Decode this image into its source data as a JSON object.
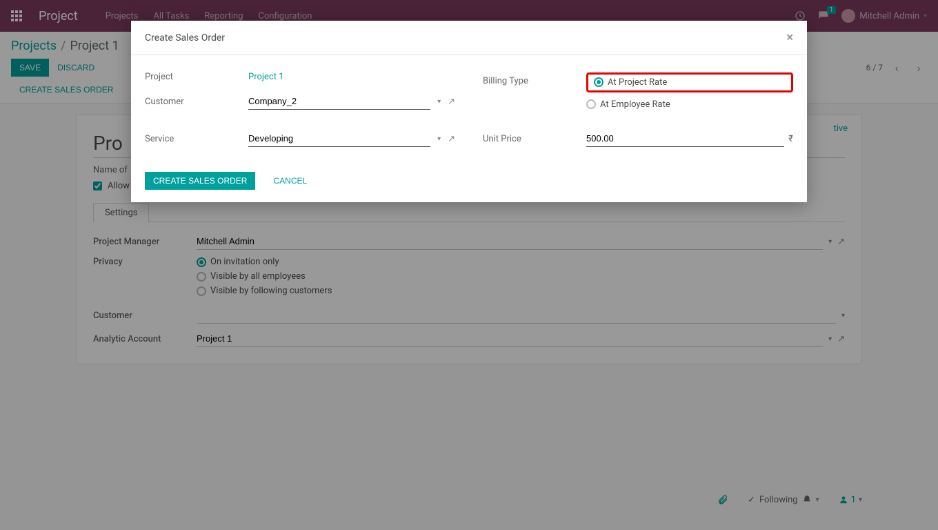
{
  "topbar": {
    "brand": "Project",
    "menu": [
      "Projects",
      "All Tasks",
      "Reporting",
      "Configuration"
    ],
    "chat_badge": "1",
    "user": "Mitchell Admin"
  },
  "breadcrumb": {
    "root": "Projects",
    "current": "Project 1"
  },
  "cp": {
    "save": "SAVE",
    "discard": "DISCARD",
    "pager": "6 / 7",
    "create_so": "CREATE SALES ORDER"
  },
  "sheet": {
    "status_active": "tive",
    "title_partial": "Pro",
    "name_label": "Name of",
    "allow_label": "Allow",
    "tab_settings": "Settings",
    "pm_label": "Project Manager",
    "pm_value": "Mitchell Admin",
    "privacy_label": "Privacy",
    "privacy_opts": [
      "On invitation only",
      "Visible by all employees",
      "Visible by following customers"
    ],
    "customer_label": "Customer",
    "analytic_label": "Analytic Account",
    "analytic_value": "Project 1"
  },
  "modal": {
    "title": "Create Sales Order",
    "project_label": "Project",
    "project_value": "Project 1",
    "customer_label": "Customer",
    "customer_value": "Company_2",
    "billing_label": "Billing Type",
    "billing_opts": [
      "At Project Rate",
      "At Employee Rate"
    ],
    "service_label": "Service",
    "service_value": "Developing",
    "price_label": "Unit Price",
    "price_value": "500.00",
    "currency": "₹",
    "btn_create": "CREATE SALES ORDER",
    "btn_cancel": "CANCEL"
  },
  "chatter": {
    "following": "Following",
    "followers": "1"
  }
}
